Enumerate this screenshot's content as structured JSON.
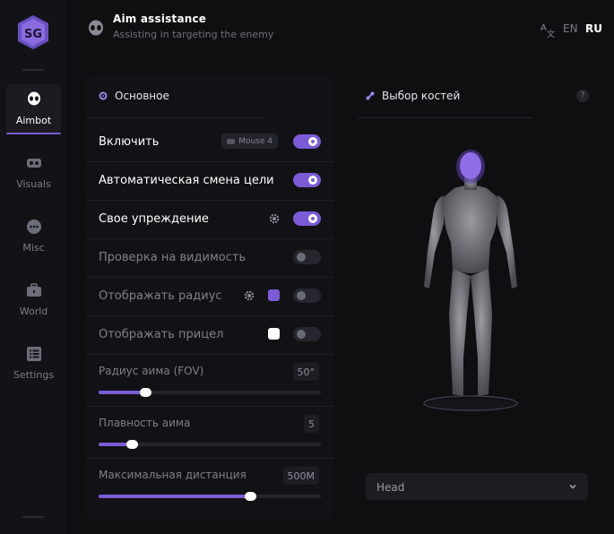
{
  "colors": {
    "accent": "#7b5bd6",
    "background": "#0f0f12",
    "panel": "#121216"
  },
  "sidebar": {
    "items": [
      {
        "label": "Aimbot",
        "icon": "alien-icon",
        "active": true
      },
      {
        "label": "Visuals",
        "icon": "vr-goggles-icon",
        "active": false
      },
      {
        "label": "Misc",
        "icon": "dots-icon",
        "active": false
      },
      {
        "label": "World",
        "icon": "toolbox-icon",
        "active": false
      },
      {
        "label": "Settings",
        "icon": "list-icon",
        "active": false
      }
    ]
  },
  "header": {
    "title": "Aim assistance",
    "subtitle": "Assisting in targeting the enemy",
    "icon": "alien-icon"
  },
  "language": {
    "options": [
      "EN",
      "RU"
    ],
    "selected": "RU",
    "icon": "translate-icon"
  },
  "main": {
    "title": "Основное",
    "rows": [
      {
        "label": "Включить",
        "enabled": true,
        "keybind": "Mouse 4"
      },
      {
        "label": "Автоматическая смена цели",
        "enabled": true
      },
      {
        "label": "Свое упреждение",
        "enabled": true,
        "has_settings": true
      },
      {
        "label": "Проверка на видимость",
        "enabled": false
      },
      {
        "label": "Отображать радиус",
        "enabled": false,
        "has_settings": true,
        "color": "#7b5bd6"
      },
      {
        "label": "Отображать прицел",
        "enabled": false,
        "color": "#ffffff"
      }
    ],
    "sliders": [
      {
        "label": "Радиус аима (FOV)",
        "value": "50°",
        "fraction": 0.21
      },
      {
        "label": "Плавность аима",
        "value": "5",
        "fraction": 0.15
      },
      {
        "label": "Максимальная дистанция",
        "value": "500M",
        "fraction": 0.68
      }
    ]
  },
  "bones": {
    "title": "Выбор костей",
    "help": "?",
    "selected_bone": "Head"
  }
}
